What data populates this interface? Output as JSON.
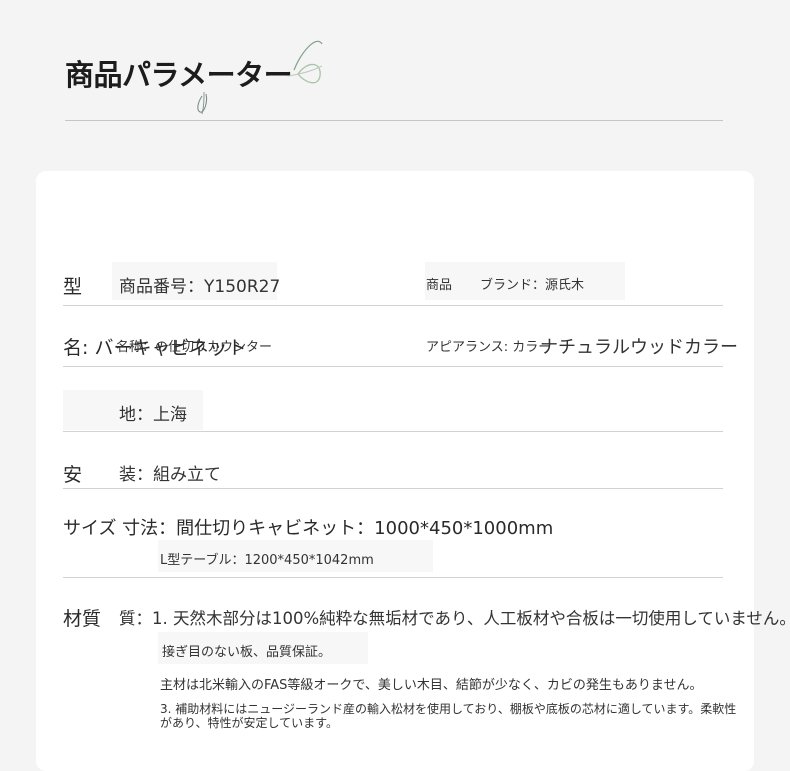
{
  "section_title": "商品パラメーター",
  "rows": {
    "model": {
      "label": "型",
      "value": "商品番号：Y150R27",
      "right_label": "商品",
      "right_value": "ブランド：源氏木"
    },
    "name": {
      "label": "名: バーキャビネット",
      "value": "名称：の仕切りカウンター",
      "right_label": "アピアランス: カラー",
      "right_value": "ナチュラルウッドカラー"
    },
    "origin": {
      "value": "地：上海"
    },
    "install": {
      "label": "安",
      "value": "装：組み立て"
    },
    "size": {
      "label": "サイズ 寸法：間仕切りキャビネット：1000*450*1000mm",
      "line2": "L型テーブル：1200*450*1042mm"
    },
    "material": {
      "label": "材質",
      "line1": "質：1. 天然木部分は100%純粋な無垢材であり、人工板材や合板は一切使用していません。",
      "line2": "接ぎ目のない板、品質保証。",
      "line3": "主材は北米輸入のFAS等級オークで、美しい木目、結節が少なく、カビの発生もありません。",
      "line4a": "3. 補助材料にはニュージーランド産の輸入松材を使用しており、棚板や底板の芯材に適しています。柔軟性",
      "line4b": "があり、特性が安定しています。"
    }
  },
  "colors": {
    "background": "#f4f4f4",
    "card": "#ffffff",
    "rule": "#d2d2d2"
  },
  "decoration": "leaf-sprig-icon"
}
